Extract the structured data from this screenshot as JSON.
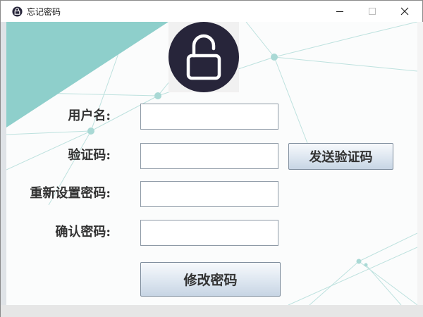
{
  "window": {
    "title": "忘记密码",
    "app_icon": "lock-app-icon",
    "controls": [
      "minimize-icon",
      "maximize-icon",
      "close-icon"
    ]
  },
  "header_icon": "unlocked-padlock-icon",
  "form": {
    "username": {
      "label": "用户名:",
      "value": ""
    },
    "code": {
      "label": "验证码:",
      "value": ""
    },
    "new_password": {
      "label": "重新设置密码:",
      "value": ""
    },
    "confirm_password": {
      "label": "确认密码:",
      "value": ""
    }
  },
  "buttons": {
    "send_code": "发送验证码",
    "submit": "修改密码"
  },
  "colors": {
    "accent_triangle": "#8ecfcb",
    "button_gradient_top": "#f7f9fc",
    "button_gradient_bottom": "#c7d5e4",
    "icon_circle": "#27253a"
  }
}
